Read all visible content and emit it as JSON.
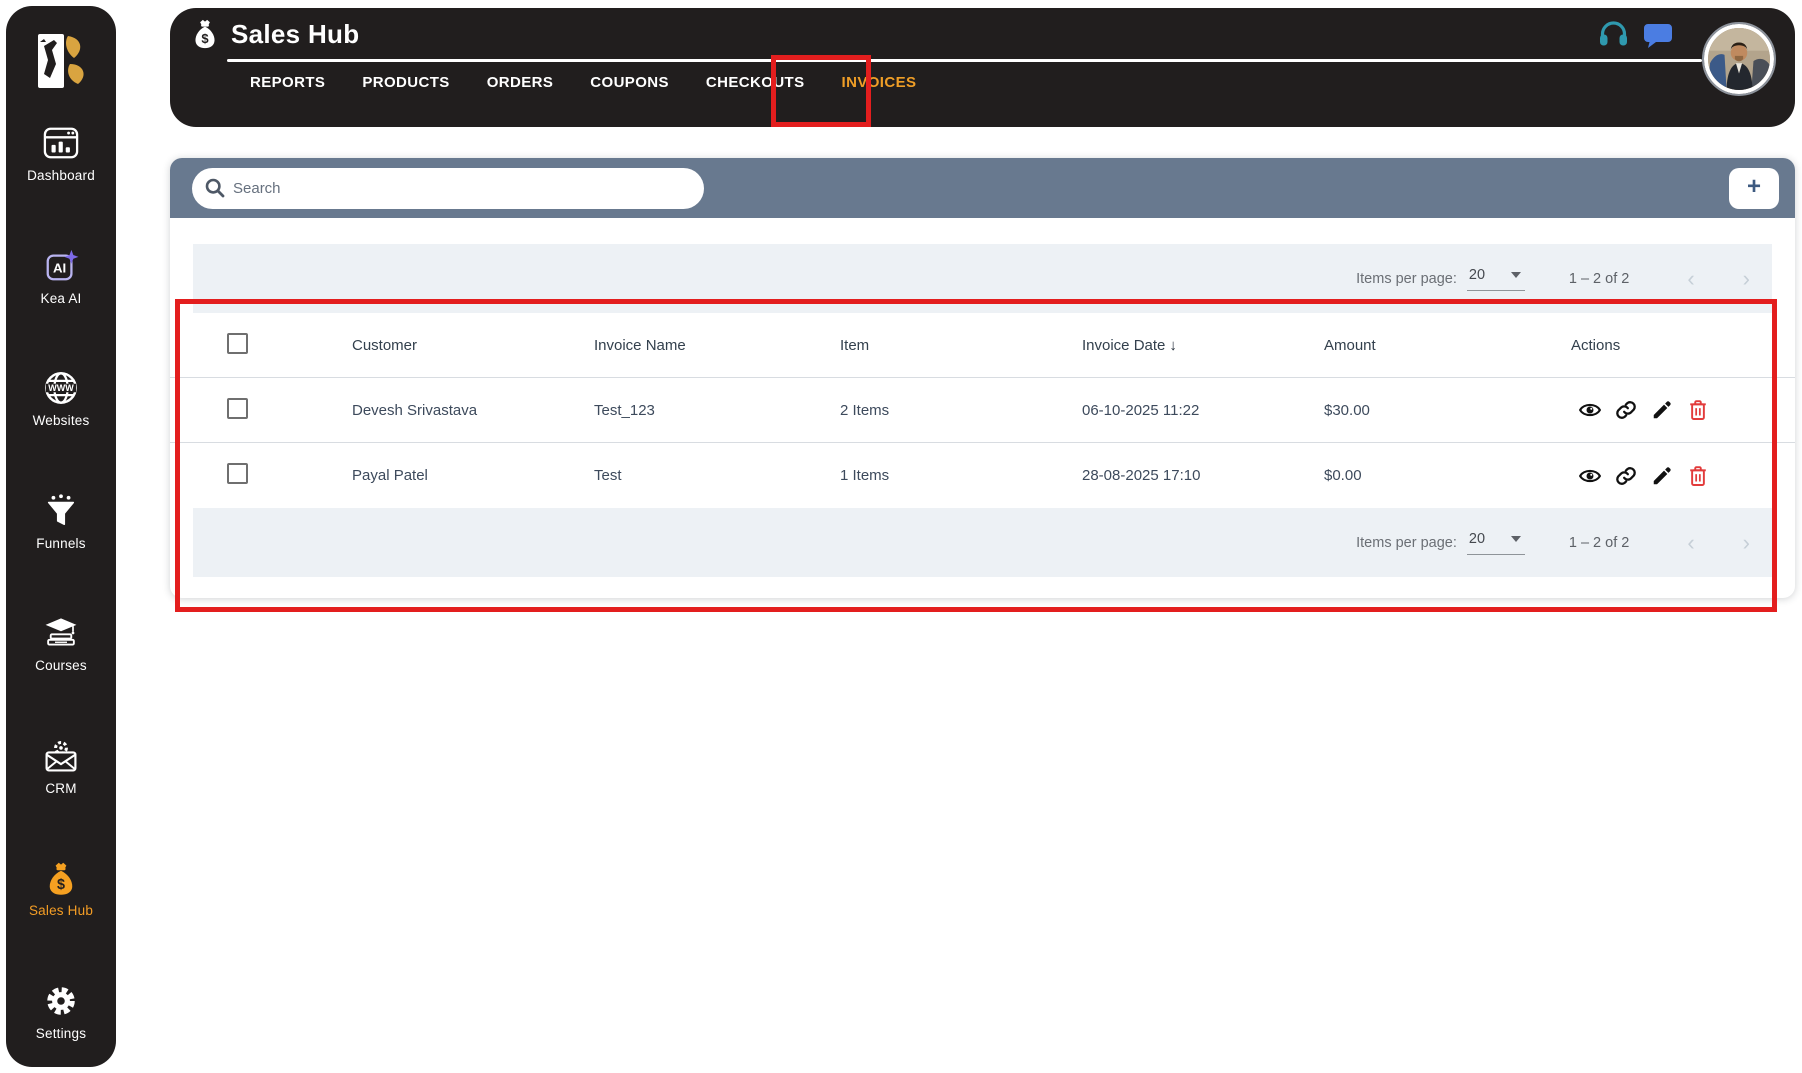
{
  "app": {
    "window_title": "Sales Hub"
  },
  "sidebar": {
    "items": [
      {
        "label": "Dashboard",
        "icon": "dashboard-icon",
        "active": false
      },
      {
        "label": "Kea AI",
        "icon": "kea-ai-icon",
        "active": false
      },
      {
        "label": "Websites",
        "icon": "websites-icon",
        "active": false
      },
      {
        "label": "Funnels",
        "icon": "funnels-icon",
        "active": false
      },
      {
        "label": "Courses",
        "icon": "courses-icon",
        "active": false
      },
      {
        "label": "CRM",
        "icon": "crm-icon",
        "active": false
      },
      {
        "label": "Sales Hub",
        "icon": "sales-hub-icon",
        "active": true
      },
      {
        "label": "Settings",
        "icon": "settings-icon",
        "active": false
      }
    ]
  },
  "header": {
    "title": "Sales Hub",
    "title_icon": "money-bag-icon",
    "tabs": [
      {
        "label": "REPORTS",
        "active": false
      },
      {
        "label": "PRODUCTS",
        "active": false
      },
      {
        "label": "ORDERS",
        "active": false
      },
      {
        "label": "COUPONS",
        "active": false
      },
      {
        "label": "CHECKOUTS",
        "active": false
      },
      {
        "label": "INVOICES",
        "active": true
      }
    ],
    "right_icons": [
      "headset-icon",
      "chat-icon",
      "avatar"
    ]
  },
  "toolbar": {
    "search_placeholder": "Search",
    "add_button_label": "+"
  },
  "table": {
    "columns": {
      "customer": "Customer",
      "invoice_name": "Invoice Name",
      "item": "Item",
      "invoice_date": "Invoice Date",
      "amount": "Amount",
      "actions": "Actions"
    },
    "sort": {
      "column": "Invoice Date",
      "direction": "desc",
      "arrow": "↓"
    },
    "rows": [
      {
        "customer": "Devesh Srivastava",
        "invoice_name": "Test_123",
        "item": "2 Items",
        "invoice_date": "06-10-2025 11:22",
        "amount": "$30.00"
      },
      {
        "customer": "Payal Patel",
        "invoice_name": "Test",
        "item": "1 Items",
        "invoice_date": "28-08-2025 17:10",
        "amount": "$0.00"
      }
    ],
    "row_actions": [
      "view",
      "copy-link",
      "edit",
      "delete"
    ]
  },
  "pagination": {
    "items_per_page_label": "Items per page:",
    "items_per_page": "20",
    "range_label": "1 – 2 of 2",
    "prev": "‹",
    "next": "›"
  },
  "annotations": {
    "shape": "red-rectangle",
    "count": 2
  },
  "colors": {
    "dark": "#211e1e",
    "accent_orange": "#f49d25",
    "tab_active_orange": "#ef9e27",
    "toolbar_slate": "#68798f",
    "strip_gray": "#edf1f5",
    "annotation_red": "#e31e1e",
    "delete_red": "#e23b3b",
    "chat_blue": "#4b7de2",
    "headset_teal": "#2f99ae"
  }
}
